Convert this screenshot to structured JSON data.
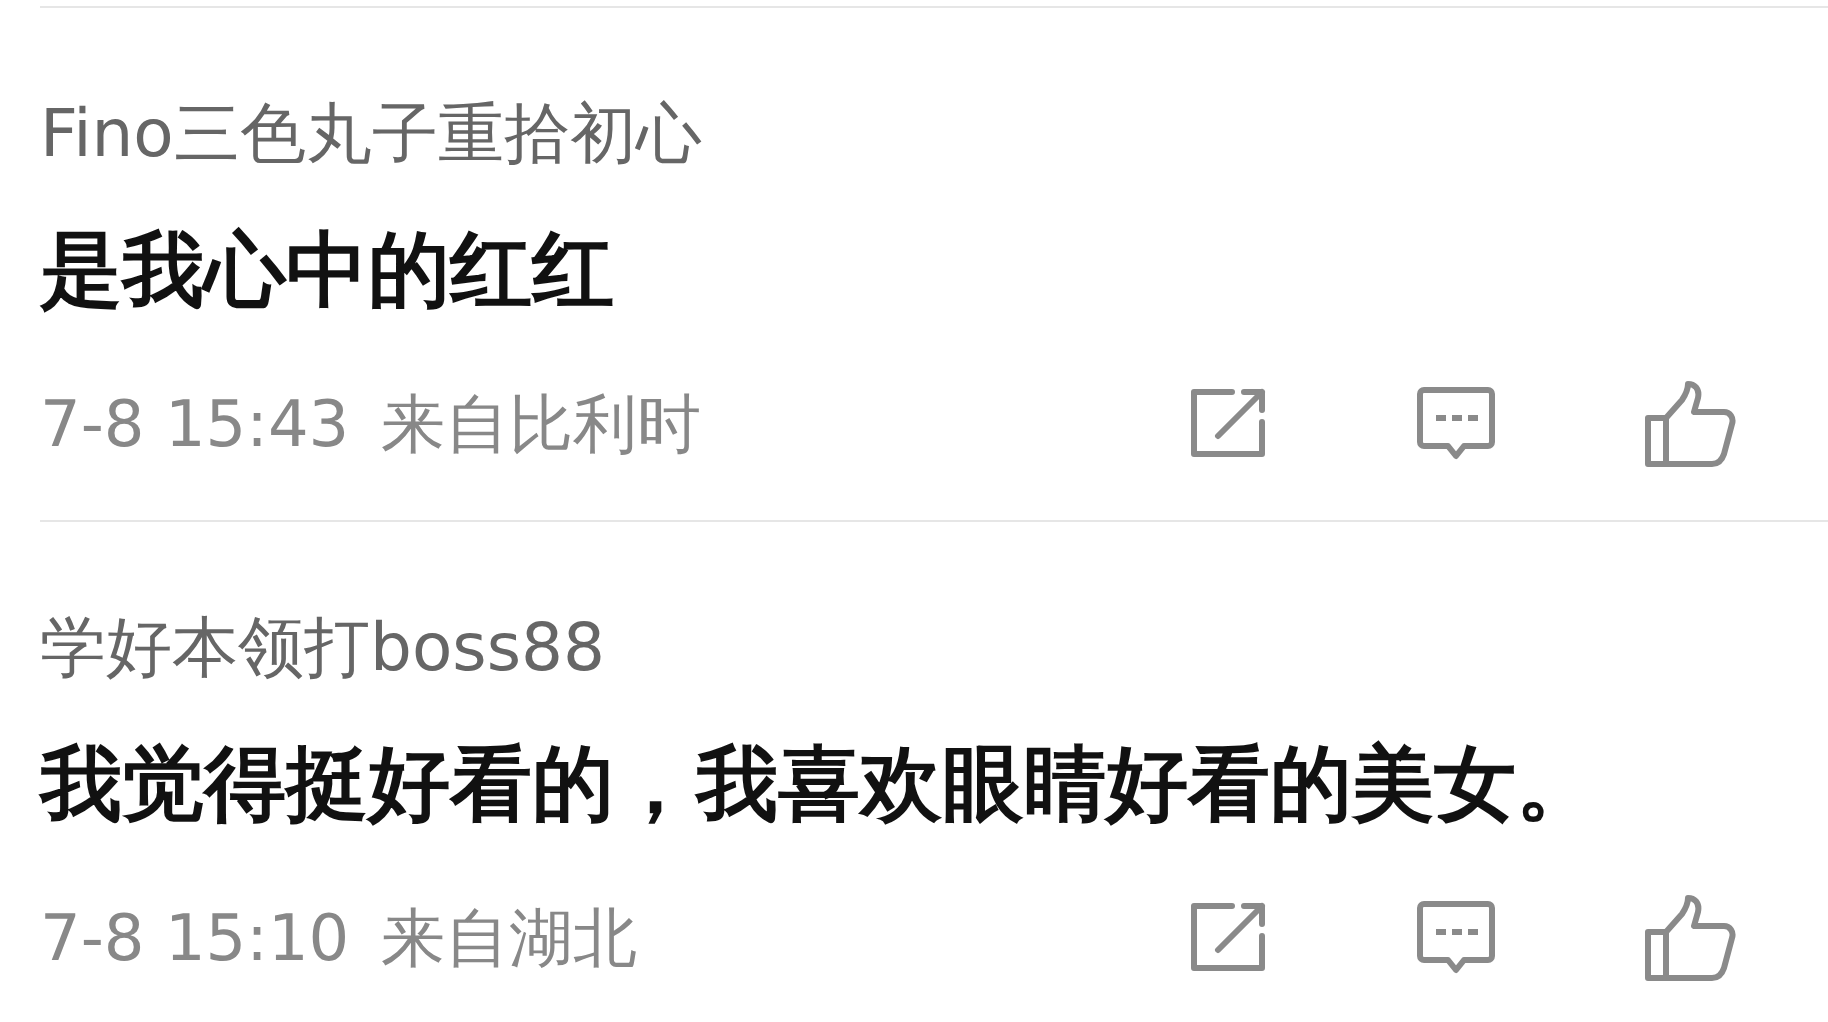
{
  "comments": [
    {
      "author": "Fino三色丸子重拾初心",
      "text": "是我心中的红红",
      "time": "7-8 15:43",
      "location": "来自比利时"
    },
    {
      "author": "学好本领打boss88",
      "text": "我觉得挺好看的，我喜欢眼睛好看的美女。",
      "time": "7-8 15:10",
      "location": "来自湖北"
    }
  ]
}
